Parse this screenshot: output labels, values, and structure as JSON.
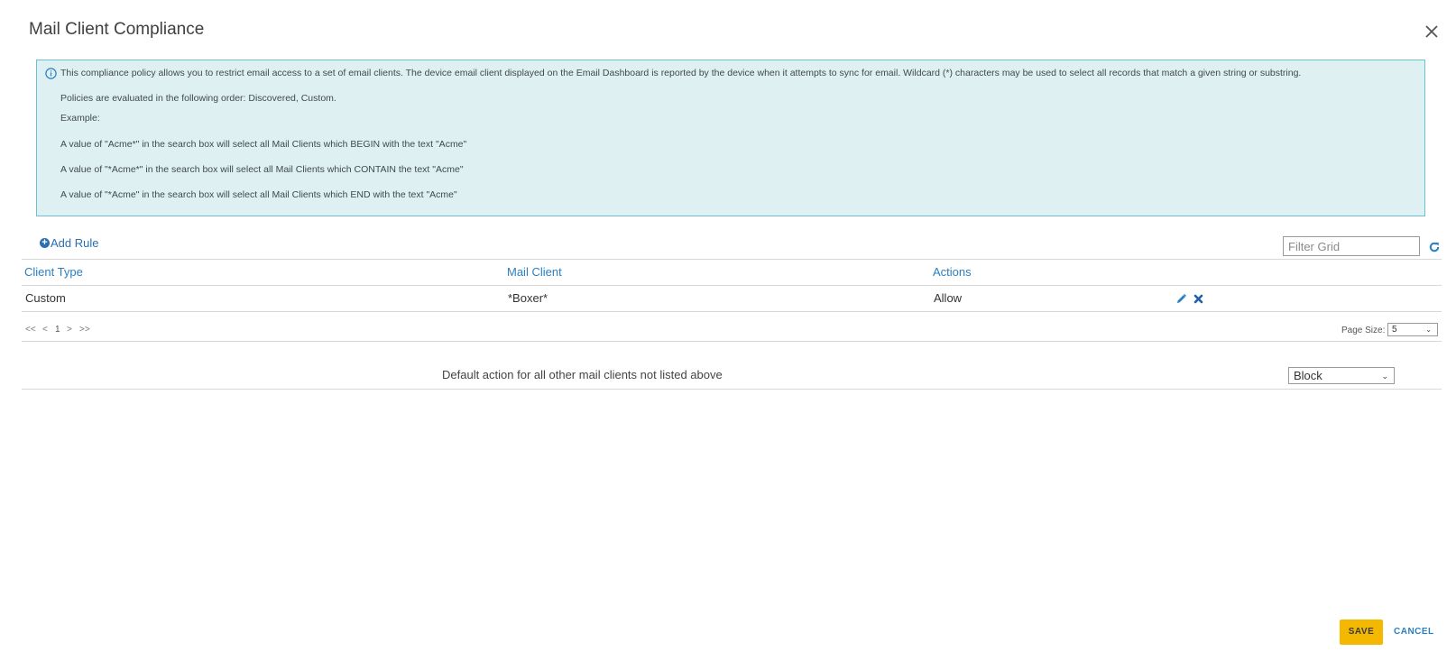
{
  "dialog": {
    "title": "Mail Client Compliance"
  },
  "info": {
    "lines": [
      "This compliance policy allows you to restrict email access to a set of email clients. The device email client displayed on the Email Dashboard is reported by the device when it attempts to sync for email. Wildcard (*) characters may be used to select all records that match a given string or substring.",
      "Policies are evaluated in the following order: Discovered, Custom.",
      "Example:",
      "A value of \"Acme*\" in the search box will select all Mail Clients which BEGIN with the text \"Acme\"",
      "A value of \"*Acme*\" in the search box will select all Mail Clients which CONTAIN the text \"Acme\"",
      "A value of \"*Acme\" in the search box will select all Mail Clients which END with the text \"Acme\""
    ]
  },
  "toolbar": {
    "add_rule_label": "Add Rule",
    "filter_placeholder": "Filter Grid"
  },
  "grid": {
    "columns": [
      "Client Type",
      "Mail Client",
      "Actions"
    ],
    "rows": [
      {
        "client_type": "Custom",
        "mail_client": "*Boxer*",
        "action": "Allow"
      }
    ]
  },
  "pager": {
    "first": "<<",
    "prev": "<",
    "page": "1",
    "next": ">",
    "last": ">>",
    "page_size_label": "Page Size:",
    "page_size": "5"
  },
  "default_action": {
    "label": "Default action for all other mail clients not listed above",
    "value": "Block"
  },
  "footer": {
    "save_label": "SAVE",
    "cancel_label": "CANCEL"
  },
  "colors": {
    "accent": "#2a7fc0",
    "save_button": "#f5b800",
    "info_background": "#dff0f2",
    "info_border": "#6bbfd0"
  },
  "icons": [
    "close-icon",
    "info-icon",
    "plus-circle-icon",
    "refresh-icon",
    "edit-icon",
    "delete-icon",
    "chevron-down-icon"
  ]
}
